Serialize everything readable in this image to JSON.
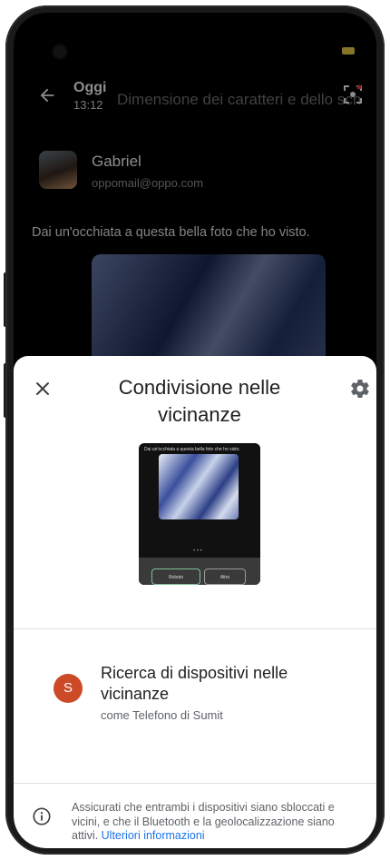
{
  "email": {
    "header_title": "Oggi",
    "header_time": "13:12",
    "background_title": "Dimensione dei caratteri e dello schermo",
    "sender_name": "Gabriel",
    "sender_email": "oppomail@oppo.com",
    "message_text": "Dai un'occhiata a questa bella foto che ho visto."
  },
  "sheet": {
    "title": "Condivisione nelle vicinanze",
    "preview": {
      "message_text": "Dai un'occhiata a questa bella foto che ho visto.",
      "button_primary": "Roboto",
      "button_secondary": "Altro"
    },
    "device": {
      "avatar_letter": "S",
      "title": "Ricerca di dispositivi nelle vicinanze",
      "subtitle": "come Telefono di Sumit"
    },
    "info": {
      "text": "Assicurati che entrambi i dispositivi siano sbloccati e vicini, e che il Bluetooth e la geolocalizzazione siano attivi. ",
      "link": "Ulteriori informazioni"
    }
  },
  "icons": {
    "close": "close-icon",
    "settings": "gear-icon",
    "info": "info-icon",
    "back": "back-arrow-icon",
    "scan": "scan-icon"
  },
  "colors": {
    "accent": "#1a73e8",
    "avatar": "#cc4a28",
    "sheet_bg": "#ffffff"
  }
}
